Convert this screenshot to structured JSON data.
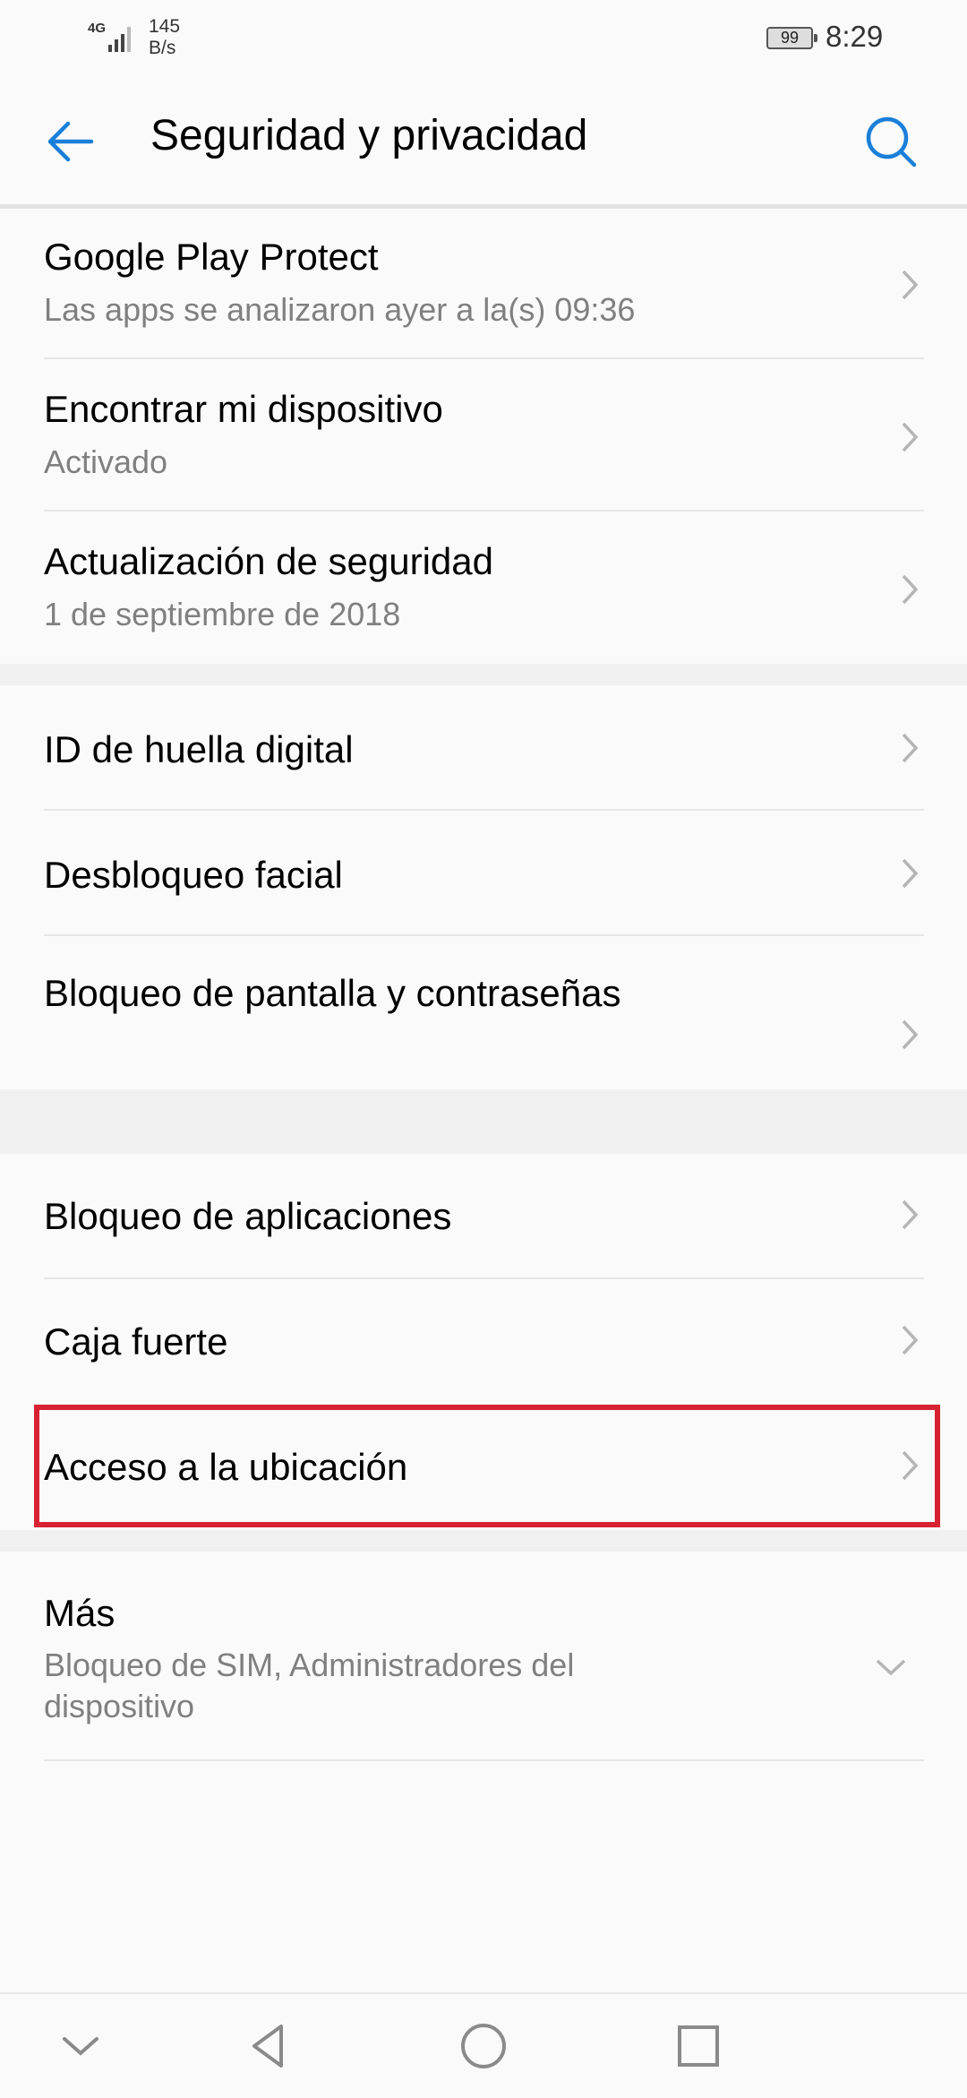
{
  "status_bar": {
    "network": "4G",
    "speed_value": "145",
    "speed_unit": "B/s",
    "battery": "99",
    "time": "8:29"
  },
  "app_bar": {
    "title": "Seguridad y privacidad",
    "back_icon": "arrow-left-icon",
    "search_icon": "search-icon",
    "accent": "#1a7fd9"
  },
  "groups": [
    {
      "items": [
        {
          "title": "Google Play Protect",
          "subtitle": "Las apps se analizaron ayer a la(s) 09:36"
        },
        {
          "title": "Encontrar mi dispositivo",
          "subtitle": "Activado"
        },
        {
          "title": "Actualización de seguridad",
          "subtitle": "1 de septiembre de 2018"
        }
      ]
    },
    {
      "items": [
        {
          "title": "ID de huella digital"
        },
        {
          "title": "Desbloqueo facial"
        },
        {
          "title": "Bloqueo de pantalla y contraseñas"
        }
      ]
    },
    {
      "items": [
        {
          "title": "Bloqueo de aplicaciones"
        },
        {
          "title": "Caja fuerte"
        },
        {
          "title": "Acceso a la ubicación",
          "highlighted": true
        }
      ]
    },
    {
      "items": [
        {
          "title": "Más",
          "subtitle": "Bloqueo de SIM, Administradores del dispositivo",
          "expandable": true
        }
      ]
    }
  ],
  "highlight_color": "#d62231",
  "nav_bar": {
    "icons": [
      "chevron-down-icon",
      "back-triangle-icon",
      "home-circle-icon",
      "recents-square-icon"
    ]
  }
}
